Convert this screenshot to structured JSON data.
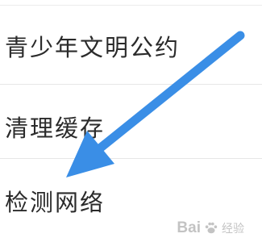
{
  "settings_menu": {
    "items": [
      {
        "label": "青少年文明公约"
      },
      {
        "label": "清理缓存"
      },
      {
        "label": "检测网络"
      }
    ]
  },
  "annotation": {
    "arrow_color": "#3a8ee6",
    "arrow_icon": "arrow-down-left-icon"
  },
  "watermark": {
    "brand": "Bai",
    "suffix": "经验"
  }
}
